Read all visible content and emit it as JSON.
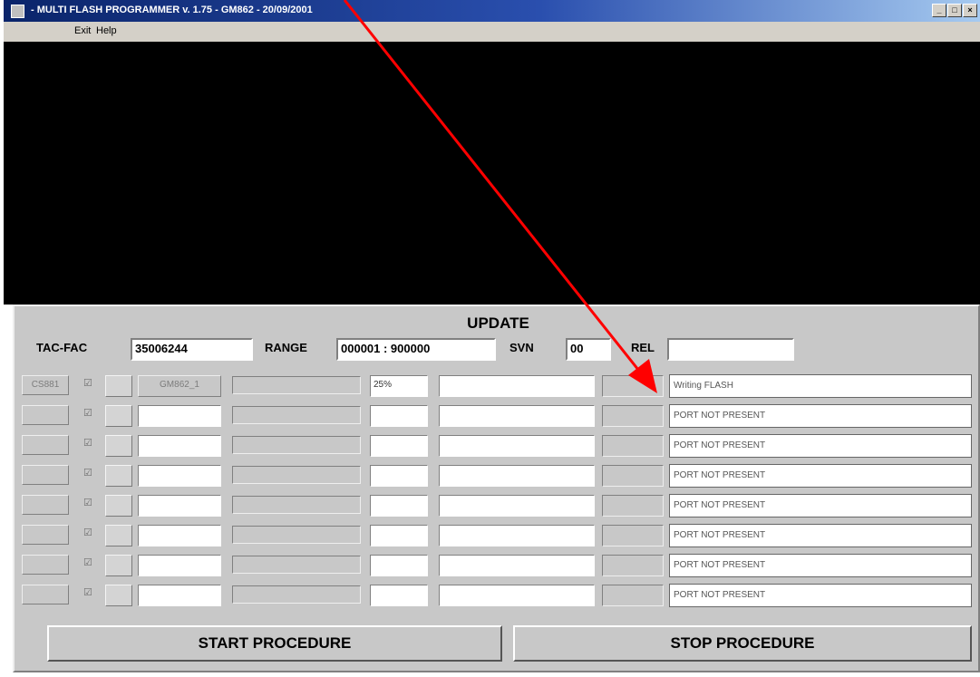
{
  "window": {
    "title": "- MULTI FLASH PROGRAMMER v. 1.75 - GM862 - 20/09/2001"
  },
  "menu": {
    "items_dim": [
      "",
      ""
    ],
    "exit": "Exit",
    "help": "Help"
  },
  "panel": {
    "heading": "UPDATE",
    "tacfac_label": "TAC-FAC",
    "tacfac_value": "35006244",
    "range_label": "RANGE",
    "range_value": "000001 : 900000",
    "svn_label": "SVN",
    "svn_value": "00",
    "rel_label": "REL",
    "rel_value": ""
  },
  "rows": [
    {
      "port": "CS881",
      "model": "GM862_1",
      "percent": "25%",
      "status": "Writing FLASH",
      "progress": 0
    },
    {
      "port": "",
      "model": "",
      "percent": "",
      "status": "PORT NOT PRESENT",
      "progress": 0
    },
    {
      "port": "",
      "model": "",
      "percent": "",
      "status": "PORT NOT PRESENT",
      "progress": 0
    },
    {
      "port": "",
      "model": "",
      "percent": "",
      "status": "PORT NOT PRESENT",
      "progress": 0
    },
    {
      "port": "",
      "model": "",
      "percent": "",
      "status": "PORT NOT PRESENT",
      "progress": 0
    },
    {
      "port": "",
      "model": "",
      "percent": "",
      "status": "PORT NOT PRESENT",
      "progress": 0
    },
    {
      "port": "",
      "model": "",
      "percent": "",
      "status": "PORT NOT PRESENT",
      "progress": 0
    },
    {
      "port": "",
      "model": "",
      "percent": "",
      "status": "PORT NOT PRESENT",
      "progress": 0
    }
  ],
  "checkbox_glyph": "☑",
  "buttons": {
    "start": "START PROCEDURE",
    "stop": "STOP PROCEDURE"
  },
  "colors": {
    "titlebar": "#0a246a",
    "screen": "#000000",
    "panel": "#c8c8c8",
    "arrow": "#ff0000"
  }
}
